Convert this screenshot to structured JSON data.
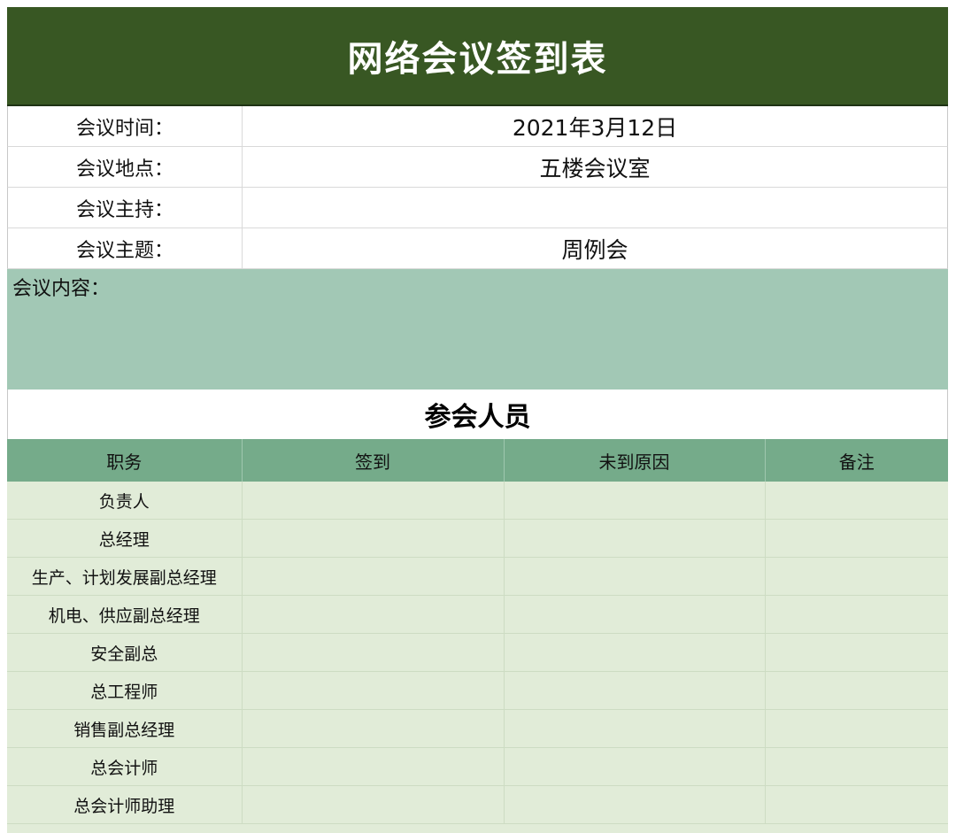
{
  "title": "网络会议签到表",
  "info": [
    {
      "label": "会议时间：",
      "value": "2021年3月12日"
    },
    {
      "label": "会议地点：",
      "value": "五楼会议室"
    },
    {
      "label": "会议主持：",
      "value": ""
    },
    {
      "label": "会议主题：",
      "value": "周例会"
    }
  ],
  "content_label": "会议内容：",
  "attendees_title": "参会人员",
  "table": {
    "headers": [
      "职务",
      "签到",
      "未到原因",
      "备注"
    ],
    "rows": [
      {
        "role": "负责人",
        "sign": "",
        "reason": "",
        "note": ""
      },
      {
        "role": "总经理",
        "sign": "",
        "reason": "",
        "note": ""
      },
      {
        "role": "生产、计划发展副总经理",
        "sign": "",
        "reason": "",
        "note": ""
      },
      {
        "role": "机电、供应副总经理",
        "sign": "",
        "reason": "",
        "note": ""
      },
      {
        "role": "安全副总",
        "sign": "",
        "reason": "",
        "note": ""
      },
      {
        "role": "总工程师",
        "sign": "",
        "reason": "",
        "note": ""
      },
      {
        "role": "销售副总经理",
        "sign": "",
        "reason": "",
        "note": ""
      },
      {
        "role": "总会计师",
        "sign": "",
        "reason": "",
        "note": ""
      },
      {
        "role": "总会计师助理",
        "sign": "",
        "reason": "",
        "note": ""
      }
    ]
  },
  "colors": {
    "title_bg": "#385723",
    "content_bg": "#a2c8b5",
    "header_bg": "#75ab8a",
    "row_bg": "#e1ecd8"
  }
}
